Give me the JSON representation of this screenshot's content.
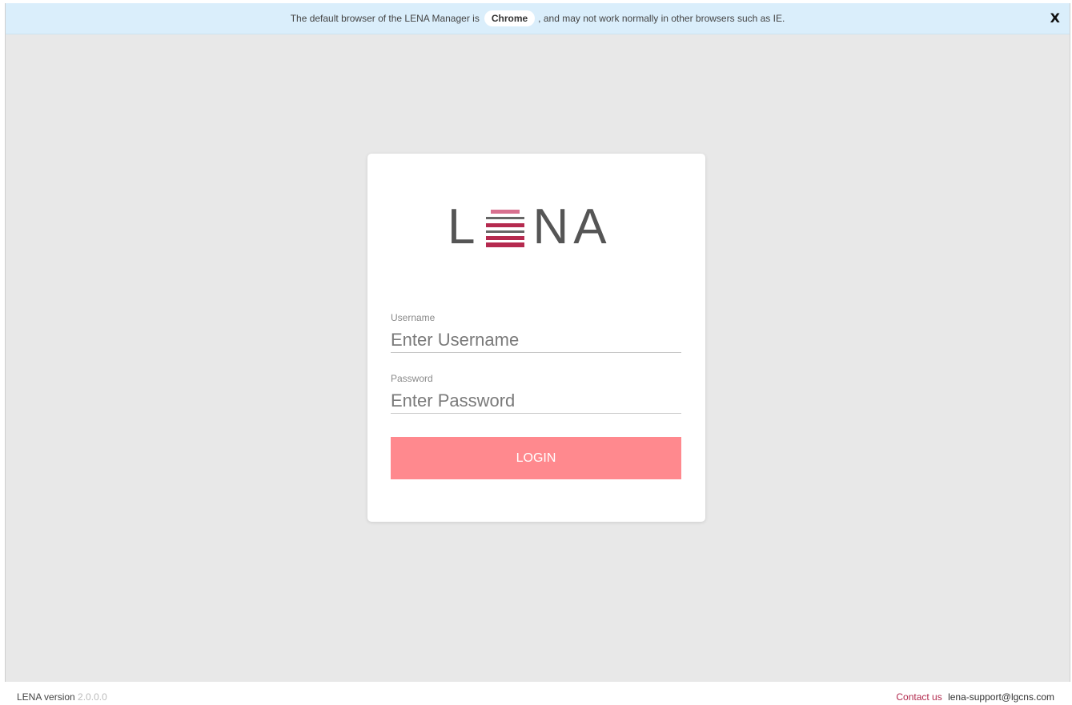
{
  "notice": {
    "text_before": "The default browser of the LENA Manager is",
    "browser_name": "Chrome",
    "text_after": ", and may not work normally in other browsers such as IE.",
    "close_label": "X"
  },
  "logo": {
    "letter_l": "L",
    "letters_na": "NA",
    "colors": {
      "stripe_light": "#d8708f",
      "stripe_gray": "#666666",
      "stripe_dark": "#b52a4f"
    }
  },
  "login": {
    "username_label": "Username",
    "username_placeholder": "Enter Username",
    "username_value": "",
    "password_label": "Password",
    "password_placeholder": "Enter Password",
    "password_value": "",
    "button_label": "LOGIN",
    "button_color": "#ff898e"
  },
  "footer": {
    "version_label": "LENA version",
    "version_number": "2.0.0.0",
    "contact_label": "Contact us",
    "contact_email": "lena-support@lgcns.com"
  }
}
